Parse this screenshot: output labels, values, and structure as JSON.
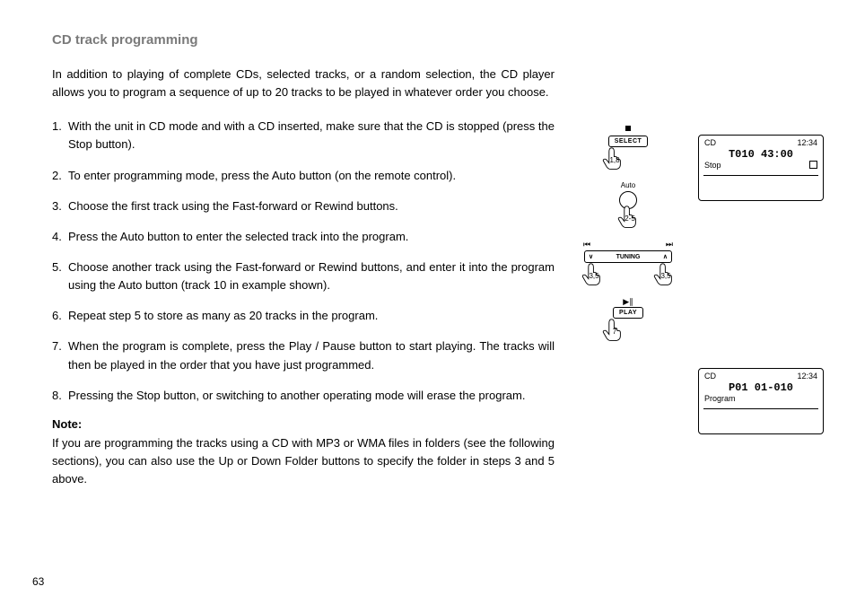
{
  "heading": "CD track programming",
  "intro": "In addition to playing of complete CDs, selected tracks, or a random selection, the CD player allows you to program a sequence of up to 20 tracks to be played in whatever order you choose.",
  "steps": [
    {
      "n": "1.",
      "t": "With the unit in CD mode and with a CD inserted, make sure that the CD is stopped (press the Stop button)."
    },
    {
      "n": "2.",
      "t": "To enter programming mode, press the Auto button (on the remote control)."
    },
    {
      "n": "3.",
      "t": "Choose the first track using the Fast-forward or Rewind buttons."
    },
    {
      "n": "4.",
      "t": "Press the Auto button to enter the selected track into the program."
    },
    {
      "n": "5.",
      "t": "Choose another track using the Fast-forward or Rewind buttons, and enter it into the program using the Auto button (track 10 in example shown)."
    },
    {
      "n": "6.",
      "t": "Repeat step 5 to store as many as 20 tracks in the program."
    },
    {
      "n": "7.",
      "t": "When the program is complete, press the Play / Pause button to start playing. The tracks will then be played in the order that you have just programmed."
    },
    {
      "n": "8.",
      "t": "Pressing the Stop button, or switching to another operating mode will erase the program."
    }
  ],
  "note_label": "Note:",
  "note_text": "If you are programming the tracks using a CD with MP3 or WMA files in folders (see the following sections), you can also use the Up or Down Folder buttons to specify the folder in steps 3 and 5 above.",
  "page_number": "63",
  "diagram": {
    "select_label": "SELECT",
    "select_steps": "1,8",
    "auto_label": "Auto",
    "auto_steps": "2-5",
    "prev_icon": "⏮",
    "next_icon": "⏭",
    "tuning_label": "TUNING",
    "down_icon": "∨",
    "up_icon": "∧",
    "tuning_steps": "3,5",
    "playpause_icon": "▶∥",
    "play_label": "PLAY",
    "play_steps": "7"
  },
  "lcd1": {
    "mode": "CD",
    "clock": "12:34",
    "title": "T010 43:00",
    "status": "Stop"
  },
  "lcd2": {
    "mode": "CD",
    "clock": "12:34",
    "title": "P01 01-010",
    "status": "Program"
  }
}
